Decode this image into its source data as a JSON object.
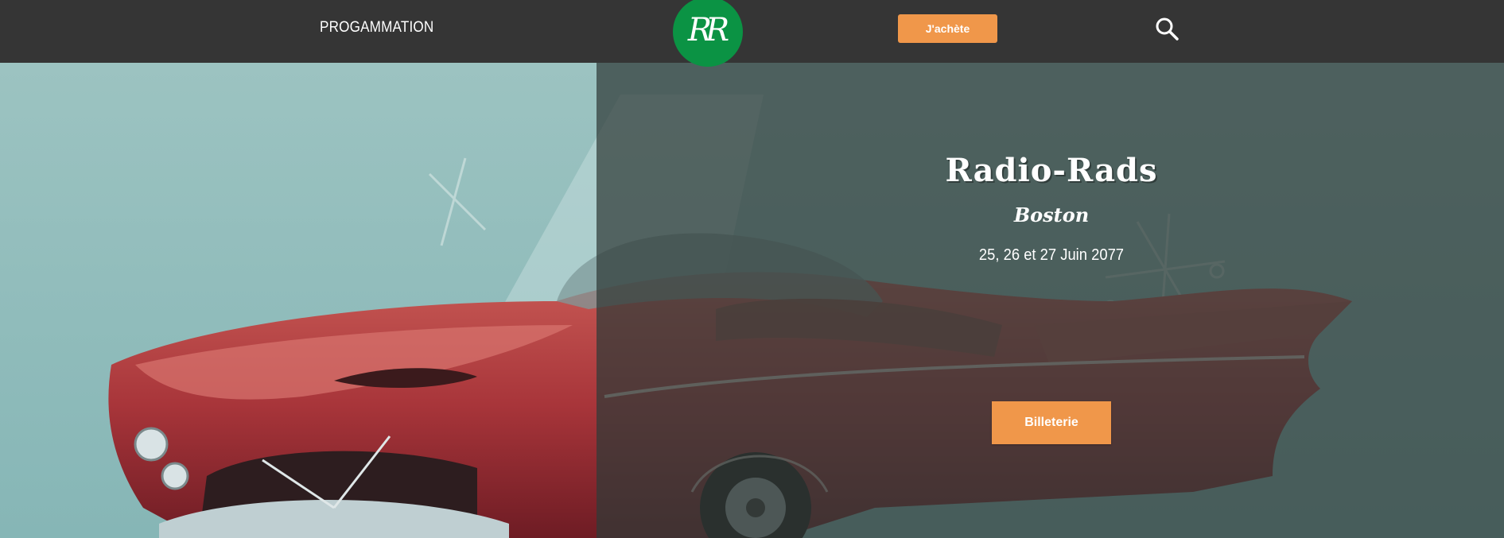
{
  "nav": {
    "program_link": "PROGAMMATION",
    "logo_text": "RR",
    "buy_label": "J'achète",
    "search_icon": "search-icon"
  },
  "hero": {
    "title": "Radio-Rads",
    "city": "Boston",
    "dates": "25, 26 et 27 Juin 2077",
    "ticket_label": "Billeterie",
    "illustration": "red-vintage-convertible-car"
  },
  "colors": {
    "navbar": "#353535",
    "logo": "#0b9344",
    "accent": "#f0974a",
    "background_light": "#8fb9b8",
    "overlay_dark": "#3f4c4a"
  }
}
